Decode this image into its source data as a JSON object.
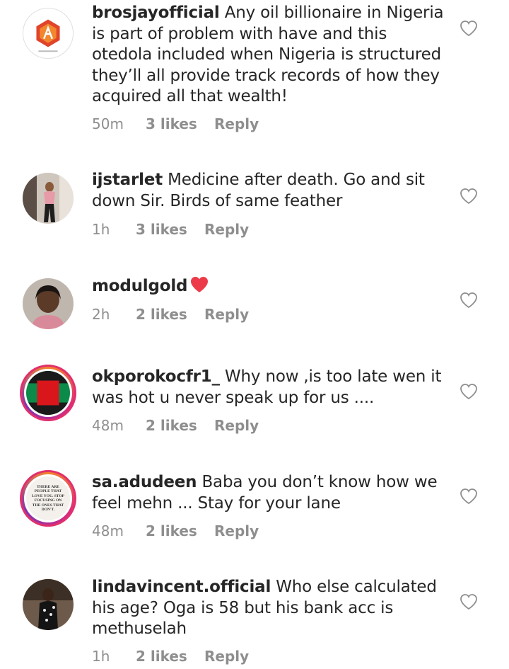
{
  "comments": [
    {
      "username": "brosjayofficial",
      "text": "Any oil billionaire in Nigeria is part of problem with have and this otedola included when Nigeria is structured they’ll all provide track records of how they acquired all that wealth!",
      "time": "50m",
      "likes": "3 likes",
      "reply": "Reply",
      "avatar_icon": "hexagon-logo-icon"
    },
    {
      "username": "ijstarlet",
      "text": "Medicine after death. Go and sit down Sir. Birds of same feather",
      "time": "1h",
      "likes": "3 likes",
      "reply": "Reply",
      "avatar_icon": "person-photo-icon"
    },
    {
      "username": "modulgold",
      "text": "",
      "emoji": "red-heart-emoji",
      "time": "2h",
      "likes": "2 likes",
      "reply": "Reply",
      "avatar_icon": "person-photo-icon"
    },
    {
      "username": "okporokocfr1_",
      "text": "Why now ,is too late wen it was hot u never speak up for us ....",
      "time": "48m",
      "likes": "2 likes",
      "reply": "Reply",
      "avatar_icon": "flag-icon"
    },
    {
      "username": "sa.adudeen",
      "text": "Baba you don’t know how we feel mehn ... Stay for your lane",
      "time": "48m",
      "likes": "2 likes",
      "reply": "Reply",
      "avatar_icon": "quote-card-icon",
      "avatar_quote": "THERE ARE PEOPLE THAT LOVE YOU. STOP FOCUSING ON THE ONES THAT DON'T."
    },
    {
      "username": "lindavincent.official",
      "text": "Who else calculated his age? Oga is 58 but his bank acc is methuselah",
      "time": "1h",
      "likes": "2 likes",
      "reply": "Reply",
      "avatar_icon": "person-photo-icon"
    }
  ],
  "colors": {
    "text": "#262626",
    "meta": "#8e8e8e",
    "heart_outline": "#8e8e8e",
    "emoji_heart": "#ed3a4a"
  }
}
